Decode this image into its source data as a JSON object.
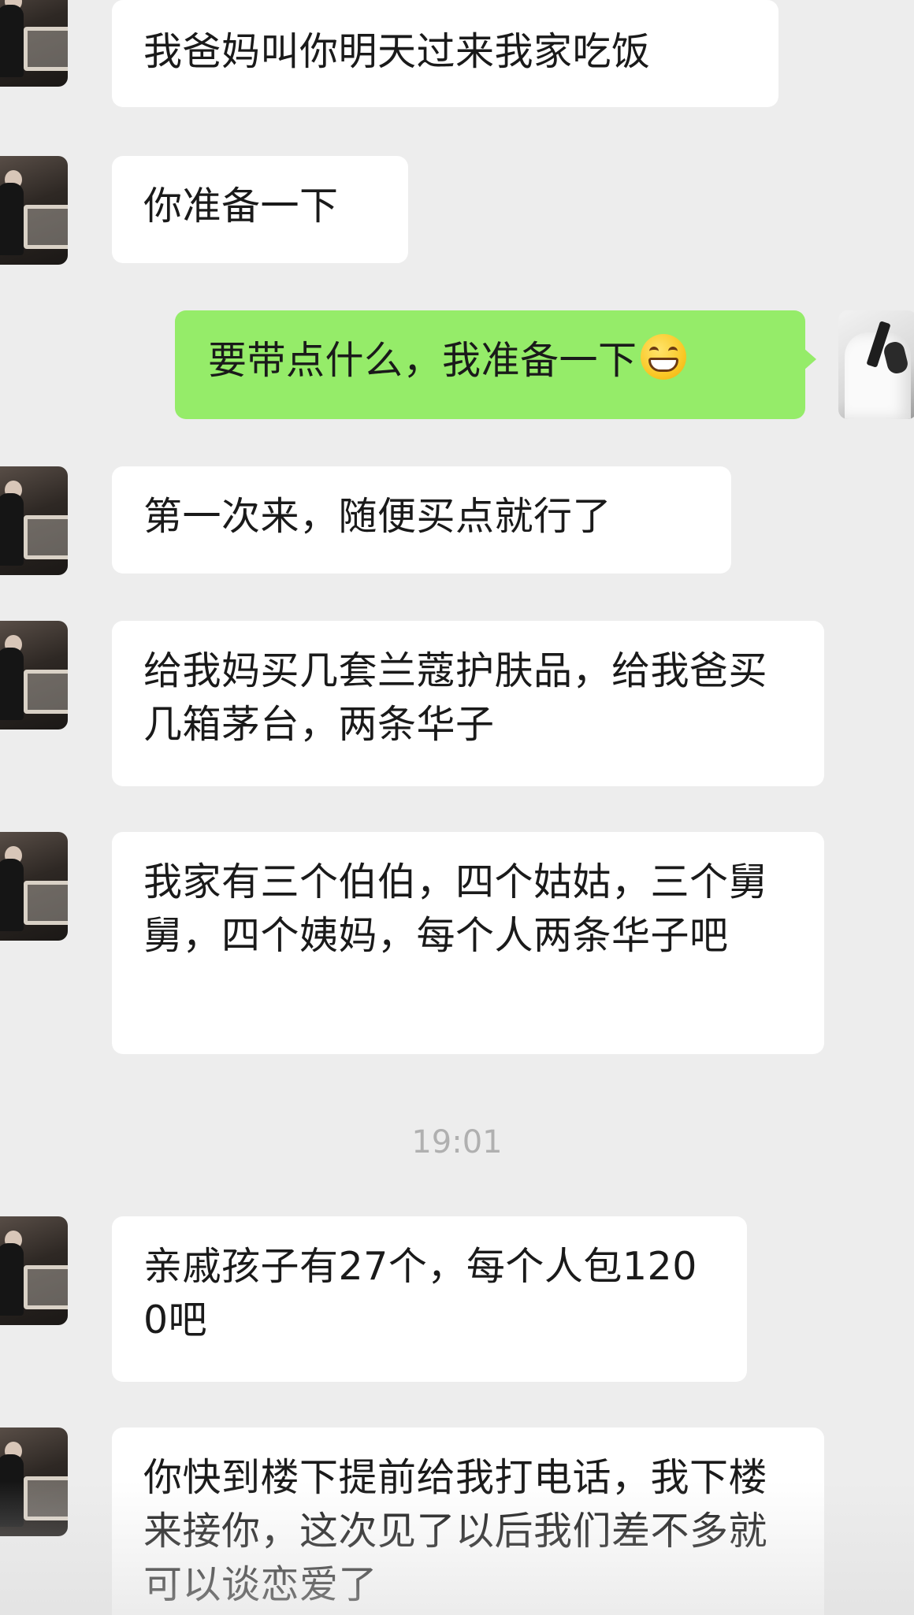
{
  "messages": [
    {
      "side": "left",
      "text": "我爸妈叫你明天过来我家吃饭"
    },
    {
      "side": "left",
      "text": "你准备一下"
    },
    {
      "side": "right",
      "text": "要带点什么，我准备一下",
      "emoji": "grinning-face-emoji"
    },
    {
      "side": "left",
      "text": "第一次来，随便买点就行了"
    },
    {
      "side": "left",
      "text": "给我妈买几套兰蔻护肤品，给我爸买几箱茅台，两条华子"
    },
    {
      "side": "left",
      "text": "我家有三个伯伯，四个姑姑，三个舅舅，四个姨妈，每个人两条华子吧"
    },
    {
      "side": "left",
      "text": "亲戚孩子有27个，每个人包1200吧"
    },
    {
      "side": "left",
      "text": "你快到楼下提前给我打电话，我下楼来接你，这次见了以后我们差不多就可以谈恋爱了"
    }
  ],
  "timestamp": "19:01",
  "colors": {
    "background": "#ededed",
    "incoming_bubble": "#ffffff",
    "outgoing_bubble": "#95ec69",
    "timestamp_text": "#b0b0b0"
  },
  "icons": {
    "incoming_avatar": "girl-with-chair-avatar",
    "outgoing_avatar": "man-white-shirt-tie-avatar"
  }
}
